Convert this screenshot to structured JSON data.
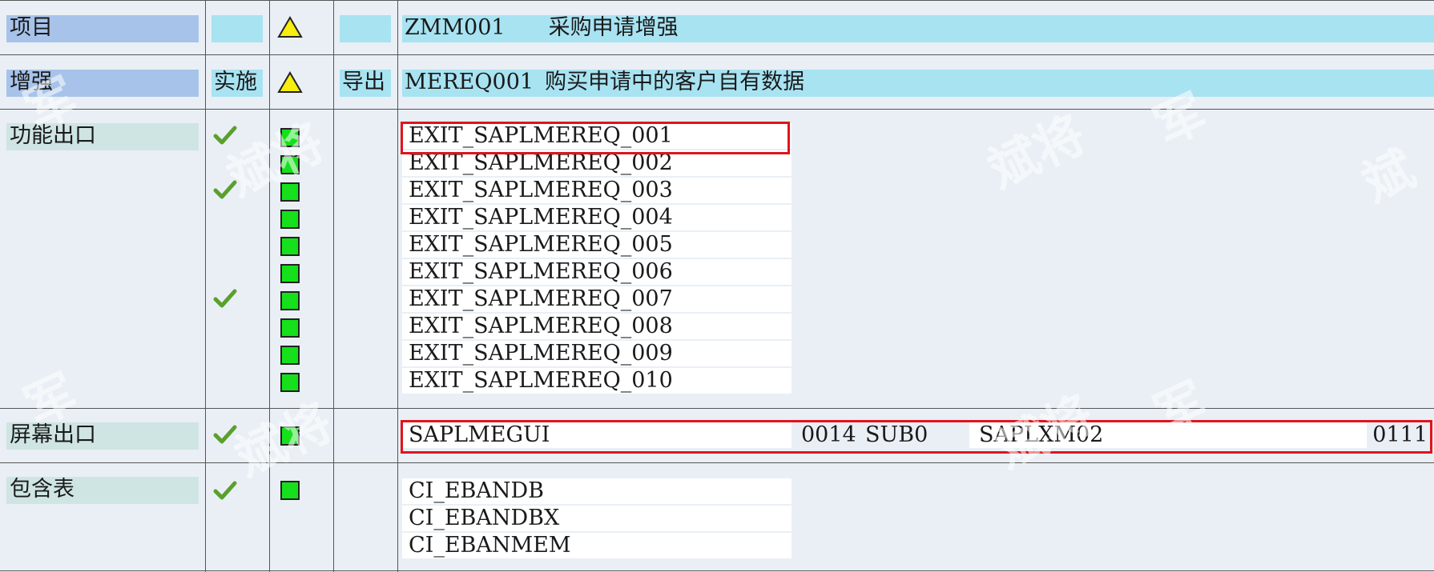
{
  "rows": {
    "project": {
      "label": "项目",
      "name": "ZMM001",
      "description": "采购申请增强"
    },
    "enhancement": {
      "label": "增强",
      "impl_label": "实施",
      "export_label": "导出",
      "name": "MEREQ001",
      "description": "购买申请中的客户自有数据"
    },
    "function_exits": {
      "label": "功能出口",
      "items": [
        {
          "name": "EXIT_SAPLMEREQ_001",
          "implemented": true
        },
        {
          "name": "EXIT_SAPLMEREQ_002",
          "implemented": false
        },
        {
          "name": "EXIT_SAPLMEREQ_003",
          "implemented": true
        },
        {
          "name": "EXIT_SAPLMEREQ_004",
          "implemented": false
        },
        {
          "name": "EXIT_SAPLMEREQ_005",
          "implemented": false
        },
        {
          "name": "EXIT_SAPLMEREQ_006",
          "implemented": false
        },
        {
          "name": "EXIT_SAPLMEREQ_007",
          "implemented": true
        },
        {
          "name": "EXIT_SAPLMEREQ_008",
          "implemented": false
        },
        {
          "name": "EXIT_SAPLMEREQ_009",
          "implemented": false
        },
        {
          "name": "EXIT_SAPLMEREQ_010",
          "implemented": false
        }
      ]
    },
    "screen_exits": {
      "label": "屏幕出口",
      "program": "SAPLMEGUI",
      "screen": "0014",
      "area": "SUB0",
      "called_program": "SAPLXM02",
      "called_screen": "0111"
    },
    "includes": {
      "label": "包含表",
      "items": [
        "CI_EBANDB",
        "CI_EBANDBX",
        "CI_EBANMEM"
      ]
    }
  },
  "colors": {
    "header_label_bg": "#a7c3ea",
    "group_label_bg": "#cfe5e3",
    "cyan_bg": "#a8e3f2",
    "status_green": "#16e01b",
    "highlight_red": "#e0141d",
    "warning_yellow": "#f5ee0f"
  },
  "icons": [
    "warning-triangle-icon",
    "checkmark-icon",
    "green-status-icon"
  ]
}
